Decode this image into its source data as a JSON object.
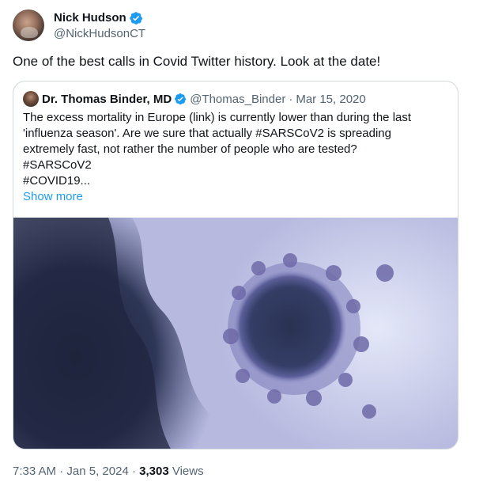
{
  "author": {
    "display_name": "Nick Hudson",
    "handle": "@NickHudsonCT"
  },
  "tweet": {
    "text": "One of the best calls in Covid Twitter history. Look at the date!"
  },
  "quoted_tweet": {
    "display_name": "Dr. Thomas Binder, MD",
    "handle": "@Thomas_Binder",
    "separator": "·",
    "date": "Mar 15, 2020",
    "lines": [
      "The excess mortality in Europe (link) is currently lower than during the last",
      "'influenza season'. Are we sure that actually #SARSCoV2 is spreading",
      "extremely fast, not rather the number of people who are tested?",
      "#SARSCoV2",
      "#COVID19..."
    ],
    "show_more": "Show more"
  },
  "footer": {
    "time": "7:33 AM",
    "separator": "·",
    "date": "Jan 5, 2024",
    "views_count": "3,303",
    "views_label": "Views"
  },
  "colors": {
    "accent": "#1d9bf0",
    "secondary_text": "#536471",
    "primary_text": "#0f1419",
    "border": "#cfd9de"
  },
  "icons": {
    "verified": "verified-badge-icon"
  }
}
